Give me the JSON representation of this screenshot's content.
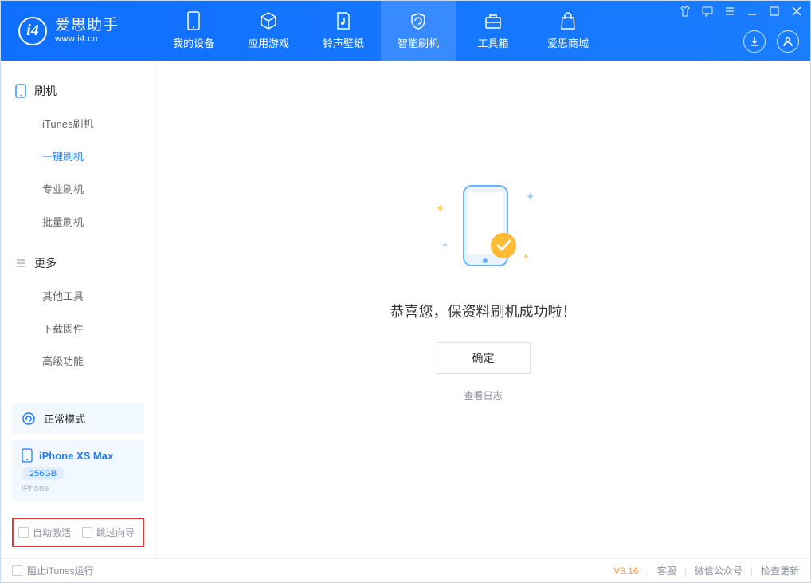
{
  "app": {
    "title": "爱思助手",
    "subtitle": "www.i4.cn"
  },
  "tabs": {
    "device": "我的设备",
    "apps": "应用游戏",
    "ringtones": "铃声壁纸",
    "flash": "智能刷机",
    "toolbox": "工具箱",
    "store": "爱思商城"
  },
  "sidebar": {
    "flash_section": "刷机",
    "items_flash": {
      "itunes": "iTunes刷机",
      "oneclick": "一键刷机",
      "pro": "专业刷机",
      "batch": "批量刷机"
    },
    "more_section": "更多",
    "items_more": {
      "other": "其他工具",
      "firmware": "下载固件",
      "advanced": "高级功能"
    }
  },
  "device_status": {
    "mode_label": "正常模式",
    "name": "iPhone XS Max",
    "storage": "256GB",
    "type": "iPhone"
  },
  "options": {
    "auto_activate": "自动激活",
    "skip_guide": "跳过向导"
  },
  "main": {
    "success_message": "恭喜您，保资料刷机成功啦！",
    "ok_button": "确定",
    "view_log": "查看日志"
  },
  "footer": {
    "block_itunes": "阻止iTunes运行",
    "version": "V8.16",
    "support": "客服",
    "wechat": "微信公众号",
    "update": "检查更新"
  }
}
